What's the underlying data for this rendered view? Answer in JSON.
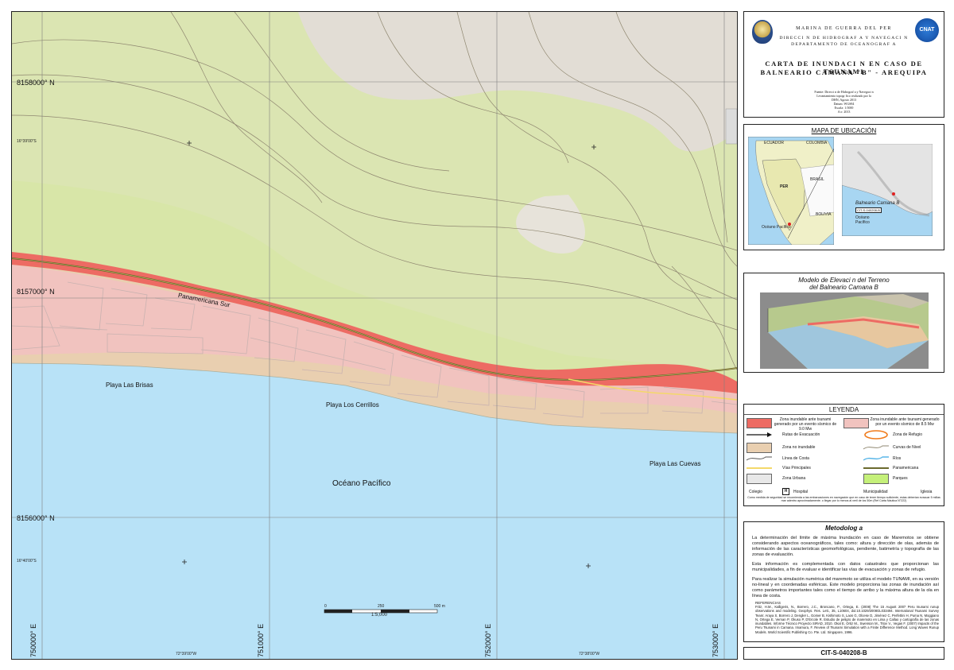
{
  "map": {
    "northing": [
      "8158000° N",
      "8157000° N",
      "8156000° N"
    ],
    "easting": [
      "750000° E",
      "751000° E",
      "752000° E",
      "753000° E"
    ],
    "lat_small": [
      "16°39'00\"S",
      "16°40'00\"S"
    ],
    "lon_small": [
      "72°39'00\"W",
      "72°38'00\"W"
    ],
    "road_label": "Panamericana Sur",
    "beach_labels": [
      "Playa Las Brisas",
      "Playa Los Cerrillos",
      "Playa Las Cuevas"
    ],
    "ocean_label": "Océano Pacífico",
    "scale": {
      "ticks": [
        "0",
        "250",
        "500 m"
      ],
      "ratio": "1:5,000"
    },
    "colors": {
      "ocean": "#b8e2f7",
      "terrain": "#dbe5b2",
      "urban": "#e8e2da",
      "inundation_9": "#ed6b63",
      "inundation_85": "#f1c3bf",
      "non_flood": "#e9cfb0"
    }
  },
  "header": {
    "org1": "MARINA DE GUERRA DEL PER",
    "org2": "DIRECCI   N DE HIDROGRAF A Y NAVEGACI  N",
    "org3": "DEPARTAMENTO DE OCEANOGRAF A",
    "title1": "CARTA DE INUNDACI   N EN CASO DE TSUNAMI",
    "title2": "BALNEARIO CAMANA \"B\" - AREQUIPA",
    "meta": [
      "Fuente: Direcci  n de Hidrograf a y Navegaci  n",
      "Levantamiento topogr  fico realizado por la",
      "DHN, Agosto 2013",
      "Datum: WGS84",
      "Escala: 1:5000",
      "A  o: 2013"
    ],
    "logo_text": "CNAT"
  },
  "ubicacion": {
    "title": "MAPA DE UBICACIÓN",
    "labels": [
      "ECUADOR",
      "COLOMBIA",
      "BRASIL",
      "PER",
      "Océano Pacífico",
      "BOLIVIA"
    ],
    "inset_label": "Balneario Camana B",
    "inset_code": "CIT-S-040208-B",
    "inset_ocean": "Océano Pacífico"
  },
  "elevation": {
    "title1": "Modelo de Elevaci  n del Terreno",
    "title2": "del Balneario Camana B"
  },
  "legend": {
    "title": "LEYENDA",
    "items": [
      {
        "label": "Zona inundable ante tsunami generado por un evento sísmico de 9.0 Mw",
        "color": "#ed6b63"
      },
      {
        "label": "Zona inundable ante tsunami generado por un evento sísmico de 8.5 Mw",
        "color": "#f1c3bf"
      },
      {
        "label": "Rutas de Evacuación"
      },
      {
        "label": "Zona de Refugio"
      },
      {
        "label": "Zona no inundable",
        "color": "#e9cfb0"
      },
      {
        "label": "Curvas de Nivel"
      },
      {
        "label": "Línea de Costa"
      },
      {
        "label": "Ríos"
      },
      {
        "label": "Vías Principales"
      },
      {
        "label": "Panamericana"
      },
      {
        "label": "Zona Urbana",
        "color": "#e8e8e8"
      },
      {
        "label": "Parques",
        "color": "#c5f07a"
      }
    ],
    "symbols": [
      "Colegio",
      "Hospital",
      "Municipalidad",
      "Iglesia"
    ],
    "note": "Como medida de seguridad se recomienda a las embarcaciones en navegación que en caso de tener tiempo suficiente, estas deberían evacuar 5 millas mar adentro aproximadamente. o llegar por lo menos al veril de los 50m (Ref Carta Náutica N°222)"
  },
  "methodology": {
    "title": "Metodolog a",
    "paragraphs": [
      "La determinación del límite de máxima Inundación en caso de Maremotos se obtiene considerando aspectos oceanográficos, tales como: altura y dirección de olas, además de información de las características geomorfológicas, pendiente, batimetría y topografía de las zonas de evaluación.",
      "Esta información es complementada con datos catastrales que proporcionan las municipalidades, a fin de evaluar e identificar las vías de evacuación y zonas de refugio.",
      "Para realizar la simulación numérica del maremoto se utiliza el modelo TUNAMI, en su versión no-lineal y en coordenadas esféricas. Este modelo proporciona las zonas de inundación así como parámetros importantes tales como el tiempo de arribo y la máxima altura de la ola en línea de costa."
    ],
    "refs_title": "REFERENCIAS",
    "refs": "Fritz, H.M., Kalligeris, N., Borrero, J.C., Broncano, P., Ortega, E. (2008) The 15 August 2007 Peru tsunami runup observations and modeling. Geophys. Res. Lett., 35, L10604, doi:10.1029/2008GL033494. International Tsunami Survey Team: Araya S, Borrero J, Dengler L, Gomer B, Kishimoto S, Laos G, Olcese D, Jiménez C, Perfettini H, Puma N, Moggiano N, Ortega E, Vernan P, Okuso P, D'Ercole R. Estudio de peligro de maremoto en Lima y Callao y cartografía de las zonas inundables. Informe Técnico Proyecto SIRAD, 2010. Okal E, Ortiz M., Swenson M., Titov V., Vegas F. (2007) Impacts of the Peru Tsunami in Camana. Imamura, F. Review of Tsunami Simulation with a Finite Difference Method. Long Waves Runup Models. World Scientific Publishing Co. Pte. Ltd. Singapore, 1996."
  },
  "code": "CIT-S-040208-B"
}
